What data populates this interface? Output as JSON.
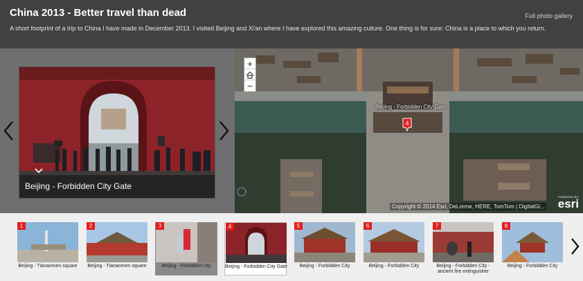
{
  "header": {
    "title": "China 2013 - Better travel than dead",
    "subtitle": "A short footprint of a trip to China I have made in December 2013. I visited Beijing and Xi'an where I have explored this amazing culture. One thing is for sure: China is a place to which you return.",
    "gallery_link": "Full photo gallery"
  },
  "media": {
    "caption": "Beijing - Forbidden City Gate",
    "prev_icon": "chevron-left-icon",
    "next_icon": "chevron-right-icon"
  },
  "map": {
    "zoom_in": "+",
    "zoom_out": "−",
    "home_icon": "home-icon",
    "label": "Beijing - Forbidden City Gate",
    "pin_number": "4",
    "copyright": "Copyright © 2014 Esri, DeLorme, HERE, TomTom | DigitalGl...",
    "powered_by": "POWERED BY",
    "brand": "esri"
  },
  "thumbnails": [
    {
      "num": "1",
      "label": "Beijing - Tiananmen square",
      "scene": "square",
      "state": "normal"
    },
    {
      "num": "2",
      "label": "Beijing - Tiananmen square",
      "scene": "gate",
      "state": "normal"
    },
    {
      "num": "3",
      "label": "Beijing - Forbidden city",
      "scene": "people",
      "state": "dim"
    },
    {
      "num": "4",
      "label": "Beijing - Forbidden City Gate",
      "scene": "arch",
      "state": "active"
    },
    {
      "num": "5",
      "label": "Beijing - Forbidden City",
      "scene": "hall",
      "state": "normal"
    },
    {
      "num": "6",
      "label": "Beijing - Forbidden City",
      "scene": "palace",
      "state": "normal"
    },
    {
      "num": "7",
      "label": "Beijing - Forbidden City - ancient fire extinguisher",
      "scene": "wall",
      "state": "normal"
    },
    {
      "num": "8",
      "label": "Beijing - Forbidden City",
      "scene": "roof",
      "state": "normal"
    }
  ],
  "colors": {
    "pin_red": "#e21d1d",
    "header_bg": "#414141"
  }
}
